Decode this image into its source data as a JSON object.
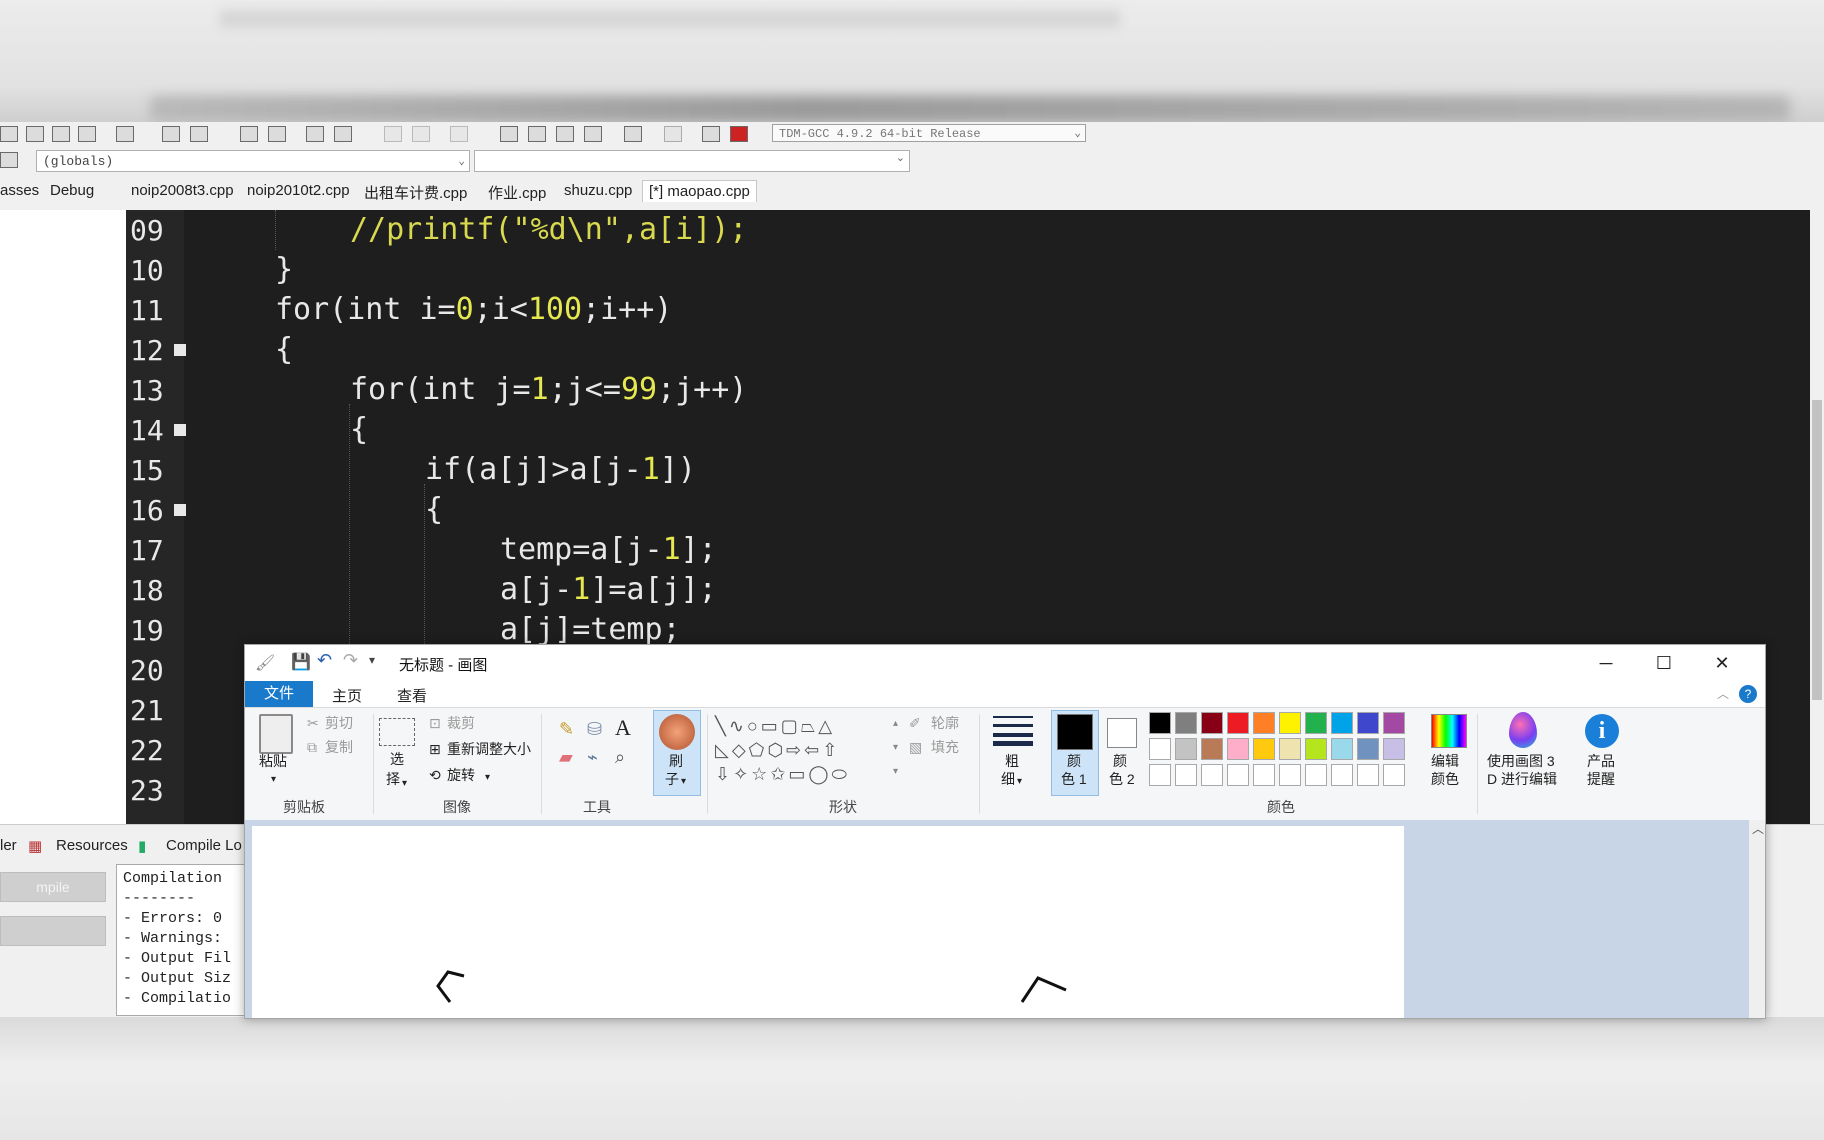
{
  "ide": {
    "compiler": "TDM-GCC 4.9.2 64-bit Release",
    "scope": "(globals)",
    "left_tabs": [
      "asses",
      "Debug"
    ],
    "file_tabs": [
      "noip2008t3.cpp",
      "noip2010t2.cpp",
      "出租车计费.cpp",
      "作业.cpp",
      "shuzu.cpp",
      "[*] maopao.cpp"
    ],
    "line_numbers": [
      "09",
      "10",
      "11",
      "12",
      "13",
      "14",
      "15",
      "16",
      "17",
      "18",
      "19",
      "20",
      "21",
      "22",
      "23"
    ],
    "code": {
      "l09": "//printf(\"%d\\n\",a[i]);",
      "l10": "}",
      "l11a": "for(int i=",
      "l11n1": "0",
      "l11b": ";i<",
      "l11n2": "100",
      "l11c": ";i++)",
      "l12": "{",
      "l13a": "for(int j=",
      "l13n1": "1",
      "l13b": ";j<=",
      "l13n2": "99",
      "l13c": ";j++)",
      "l14": "{",
      "l15a": "if(a[j]>a[j-",
      "l15n": "1",
      "l15b": "])",
      "l16": "{",
      "l17a": "temp=a[j-",
      "l17n": "1",
      "l17b": "];",
      "l18a": "a[j-",
      "l18n": "1",
      "l18b": "]=a[j];",
      "l19": "a[j]=temp;"
    },
    "bottom_tabs": [
      "ler",
      "Resources",
      "Compile Lo"
    ],
    "compile_log": [
      "Compilation",
      "--------",
      "- Errors: 0",
      "- Warnings:",
      "- Output Fil",
      "- Output Siz",
      "- Compilatio"
    ],
    "left_button": "mpile"
  },
  "paint": {
    "title": "无标题 - 画图",
    "menu": {
      "file": "文件",
      "home": "主页",
      "view": "查看"
    },
    "clipboard": {
      "paste": "粘贴",
      "cut": "剪切",
      "copy": "复制",
      "group": "剪贴板"
    },
    "image": {
      "select": "选",
      "select2": "择",
      "crop": "裁剪",
      "resize": "重新调整大小",
      "rotate": "旋转",
      "group": "图像"
    },
    "tools": {
      "group": "工具",
      "text_icon": "A"
    },
    "brush": {
      "l1": "刷",
      "l2": "子"
    },
    "shapes": {
      "outline": "轮廓",
      "fill": "填充",
      "group": "形状"
    },
    "size": {
      "l1": "粗",
      "l2": "细"
    },
    "color1": {
      "l1": "颜",
      "l2": "色 1"
    },
    "color2": {
      "l1": "颜",
      "l2": "色 2"
    },
    "colors_group": "颜色",
    "edit_colors": {
      "l1": "编辑",
      "l2": "颜色"
    },
    "paint3d": {
      "l1": "使用画图 3",
      "l2": "D 进行编辑"
    },
    "product_alert": {
      "l1": "产品",
      "l2": "提醒"
    },
    "palette_row1": [
      "#000000",
      "#7f7f7f",
      "#880015",
      "#ed1c24",
      "#ff7f27",
      "#fff200",
      "#22b14c",
      "#00a2e8",
      "#3f48cc",
      "#a349a4"
    ],
    "palette_row2": [
      "#ffffff",
      "#c3c3c3",
      "#b97a57",
      "#ffaec9",
      "#ffc90e",
      "#efe4b0",
      "#b5e61d",
      "#99d9ea",
      "#7092be",
      "#c8bfe7"
    ]
  }
}
